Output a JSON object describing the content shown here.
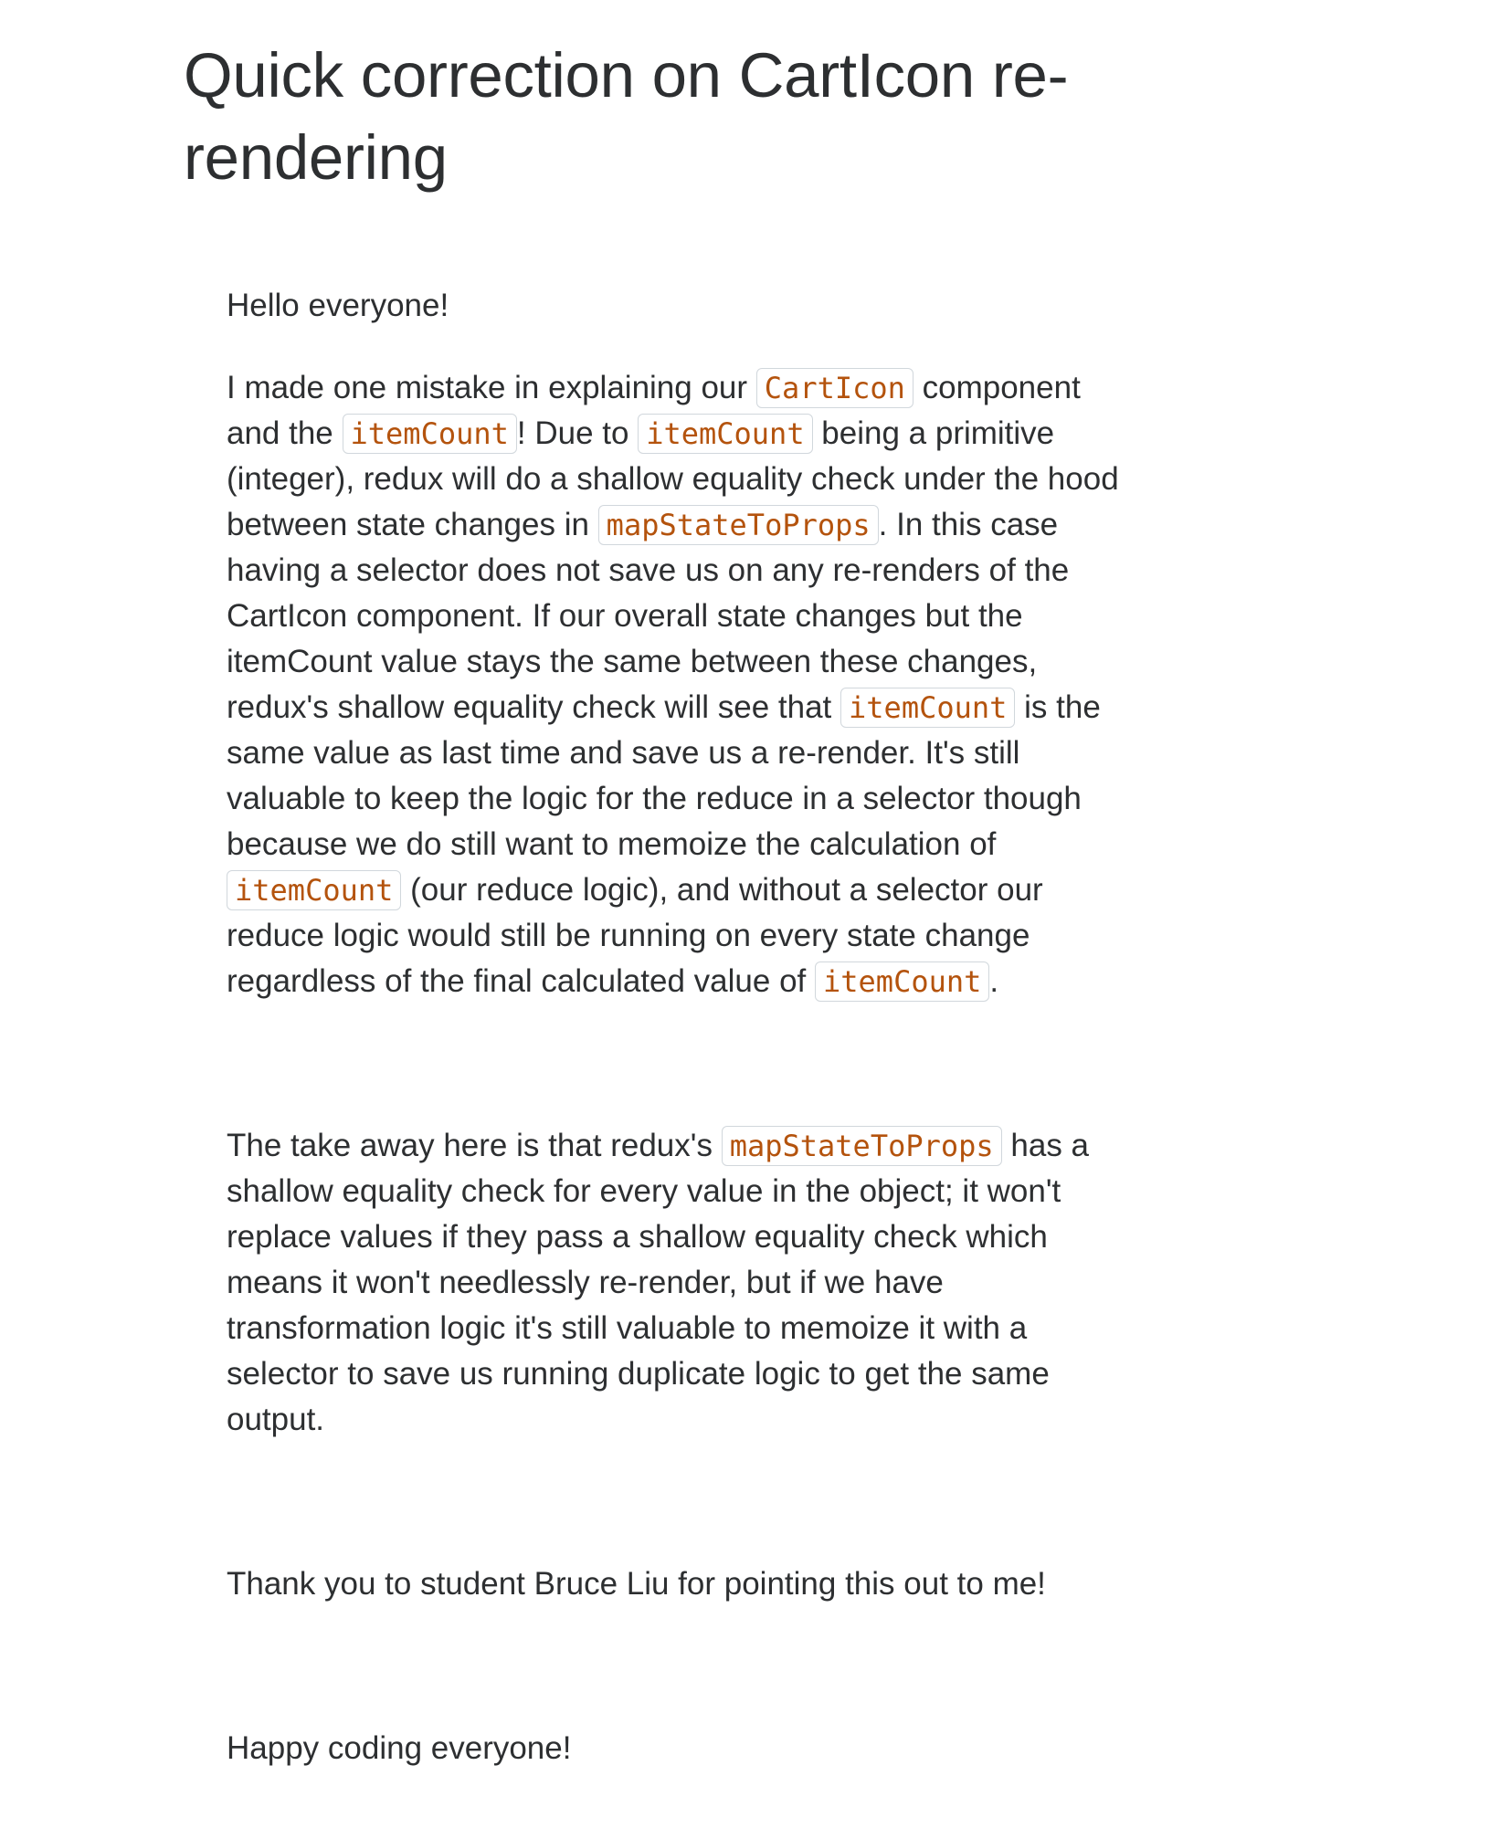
{
  "title": "Quick correction on CartIcon re-rendering",
  "greeting": "Hello everyone!",
  "main": {
    "t1": "I made one mistake in explaining our ",
    "c1": "CartIcon",
    "t2": " component and the ",
    "c2": "itemCount",
    "t3": "! Due to ",
    "c3": "itemCount",
    "t4": " being a primitive (integer), redux will do a shallow equality check under the hood between state changes in ",
    "c4": "mapStateToProps",
    "t5": ". In this case having a selector does not save us on any re-renders of the CartIcon component. If our overall state changes but the itemCount value stays the same between these changes, redux's shallow equality check will see that ",
    "c5": "itemCount",
    "t6": " is the same value as last time and save us a re-render. It's still valuable to keep the logic for the reduce in a selector though because we do still want to memoize the calculation of ",
    "c6": "itemCount",
    "t7": " (our reduce logic), and without a selector our reduce logic would still be running on every state change regardless of the final calculated value of ",
    "c7": "itemCount",
    "t8": "."
  },
  "takeaway": {
    "t1": "The take away here is that redux's ",
    "c1": "mapStateToProps",
    "t2": " has a shallow equality check for every value in the object; it won't replace values if they pass a shallow equality check which means it won't needlessly re-render, but if we have transformation logic it's still valuable to memoize it with a selector to save us running duplicate logic to get the same output."
  },
  "thanks": "Thank you to student Bruce Liu for pointing this out to me!",
  "signoff": "Happy coding everyone!",
  "colors": {
    "text": "#2d2f31",
    "code_text": "#b4530d",
    "code_border": "#d1d7dc",
    "background": "#ffffff"
  }
}
